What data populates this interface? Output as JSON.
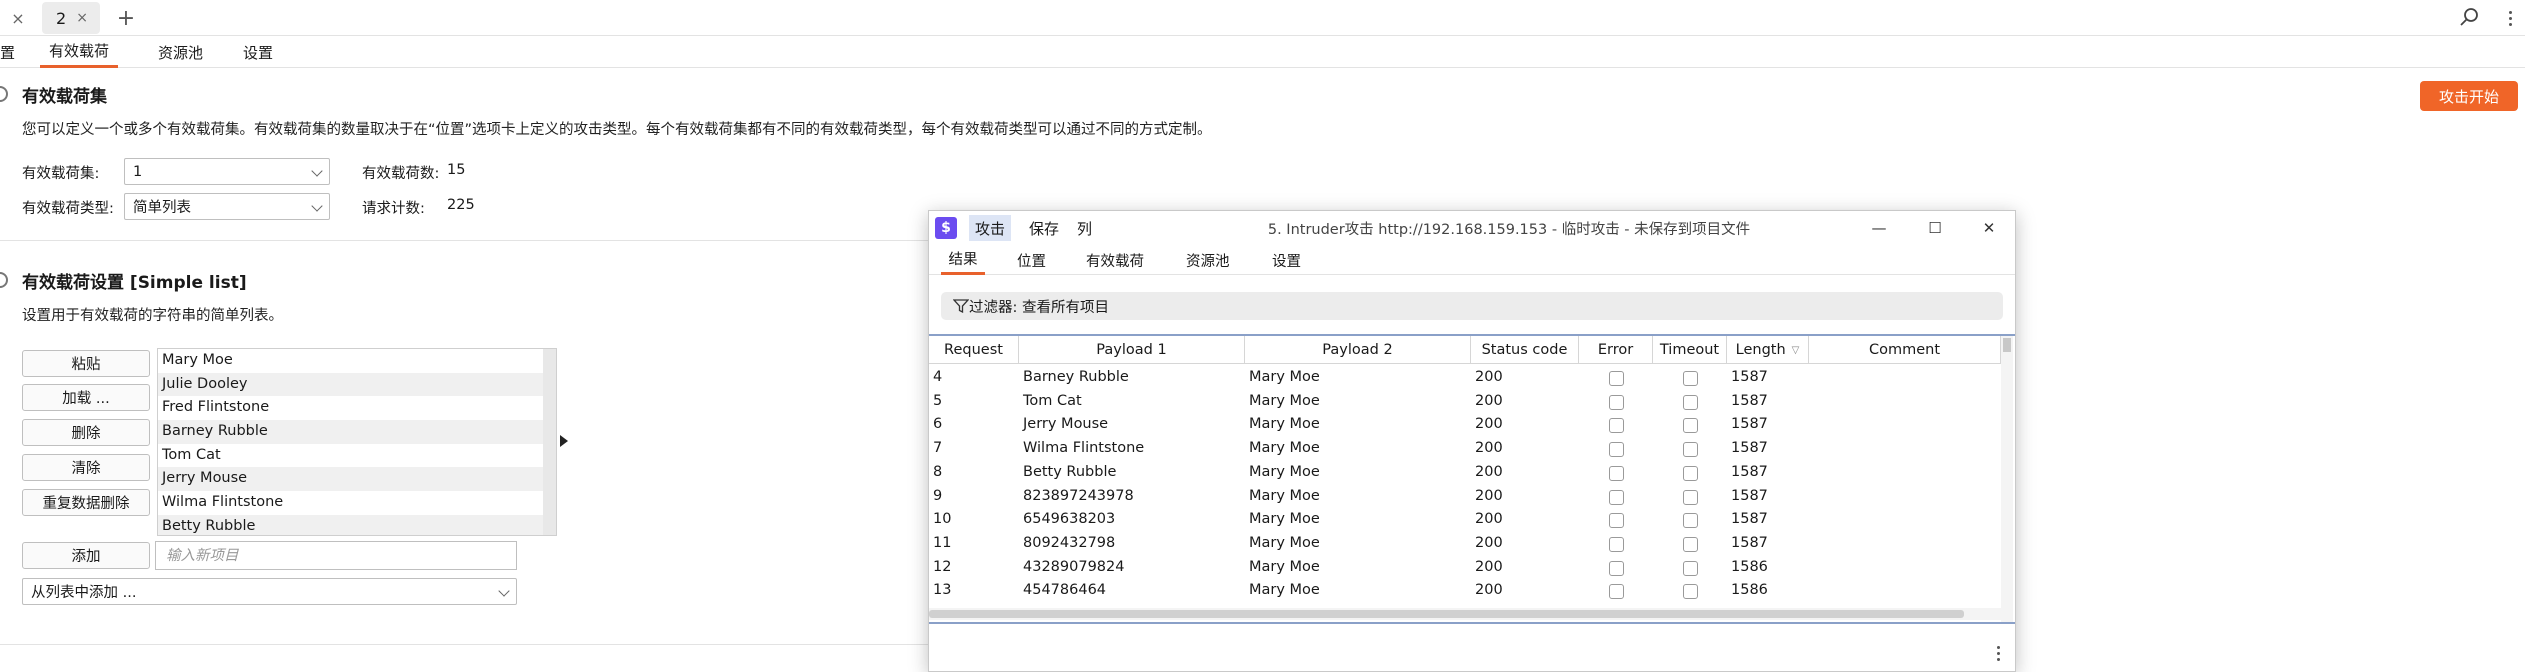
{
  "tabs": {
    "prev_close": "×",
    "current_label": "2",
    "current_close": "×",
    "add": "+"
  },
  "subtabs": {
    "positions_partial": "置",
    "payloads": "有效载荷",
    "resource_pool": "资源池",
    "settings": "设置"
  },
  "payload_sets": {
    "title": "有效载荷集",
    "description": "您可以定义一个或多个有效载荷集。有效载荷集的数量取决于在“位置”选项卡上定义的攻击类型。每个有效载荷集都有不同的有效载荷类型，每个有效载荷类型可以通过不同的方式定制。",
    "set_label": "有效载荷集:",
    "set_value": "1",
    "count_label": "有效载荷数:",
    "count_value": "15",
    "type_label": "有效载荷类型:",
    "type_value": "简单列表",
    "request_label": "请求计数:",
    "request_value": "225",
    "attack_button": "攻击开始"
  },
  "payload_settings": {
    "title": "有效载荷设置 [Simple list]",
    "description": "设置用于有效载荷的字符串的简单列表。",
    "buttons": {
      "paste": "粘贴",
      "load": "加载 ...",
      "remove": "删除",
      "clear": "清除",
      "dedupe": "重复数据删除",
      "add": "添加"
    },
    "list": [
      "Mary Moe",
      "Julie Dooley",
      "Fred Flintstone",
      "Barney Rubble",
      "Tom Cat",
      "Jerry Mouse",
      "Wilma Flintstone",
      "Betty Rubble"
    ],
    "add_placeholder": "输入新项目",
    "add_from_list": "从列表中添加 ..."
  },
  "intruder_window": {
    "logo": "$",
    "menu": {
      "attack": "攻击",
      "save": "保存",
      "columns": "列"
    },
    "caption": "5. Intruder攻击 http://192.168.159.153 - 临时攻击 - 未保存到项目文件",
    "controls": {
      "minimize": "—",
      "maximize": "☐",
      "close": "✕"
    },
    "tabs": {
      "results": "结果",
      "positions": "位置",
      "payloads": "有效载荷",
      "resource_pool": "资源池",
      "settings": "设置"
    },
    "filter": "过滤器: 查看所有项目",
    "columns": [
      "Request",
      "Payload 1",
      "Payload 2",
      "Status code",
      "Error",
      "Timeout",
      "Length",
      "Comment"
    ],
    "rows": [
      {
        "request": "4",
        "payload1": "Barney Rubble",
        "payload2": "Mary Moe",
        "status": "200",
        "length": "1587"
      },
      {
        "request": "5",
        "payload1": "Tom Cat",
        "payload2": "Mary Moe",
        "status": "200",
        "length": "1587"
      },
      {
        "request": "6",
        "payload1": "Jerry Mouse",
        "payload2": "Mary Moe",
        "status": "200",
        "length": "1587"
      },
      {
        "request": "7",
        "payload1": "Wilma Flintstone",
        "payload2": "Mary Moe",
        "status": "200",
        "length": "1587"
      },
      {
        "request": "8",
        "payload1": "Betty Rubble",
        "payload2": "Mary Moe",
        "status": "200",
        "length": "1587"
      },
      {
        "request": "9",
        "payload1": "823897243978",
        "payload2": "Mary Moe",
        "status": "200",
        "length": "1587"
      },
      {
        "request": "10",
        "payload1": "6549638203",
        "payload2": "Mary Moe",
        "status": "200",
        "length": "1587"
      },
      {
        "request": "11",
        "payload1": "8092432798",
        "payload2": "Mary Moe",
        "status": "200",
        "length": "1587"
      },
      {
        "request": "12",
        "payload1": "43289079824",
        "payload2": "Mary Moe",
        "status": "200",
        "length": "1586"
      },
      {
        "request": "13",
        "payload1": "454786464",
        "payload2": "Mary Moe",
        "status": "200",
        "length": "1586"
      }
    ]
  },
  "colors": {
    "accent": "#f06528",
    "window_logo": "#6b4cf0",
    "active_menu": "#dde5f5"
  }
}
